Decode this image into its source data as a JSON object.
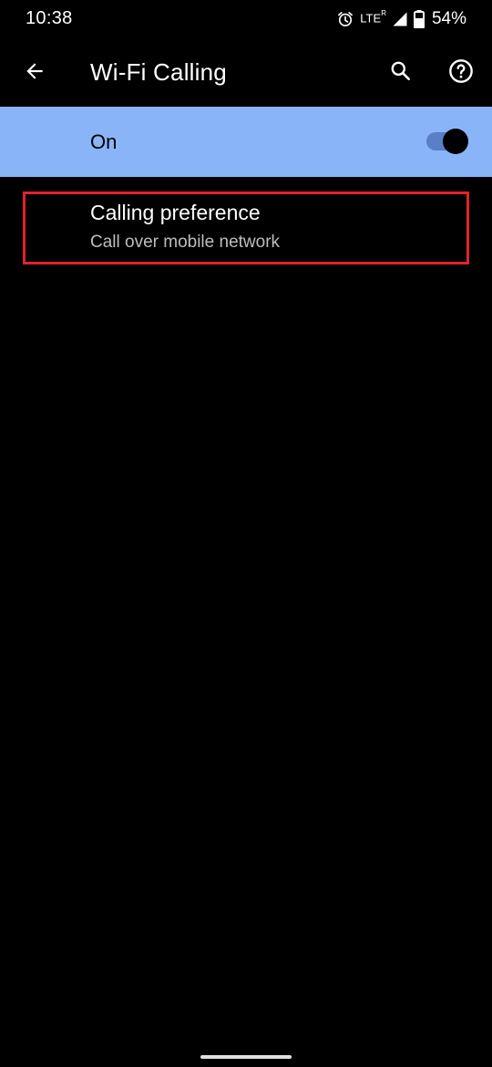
{
  "status_bar": {
    "time": "10:38",
    "network": "LTE",
    "roaming": "R",
    "battery_percent": "54%",
    "icons": [
      "alarm-icon",
      "signal-icon",
      "battery-icon"
    ]
  },
  "app_bar": {
    "title": "Wi-Fi Calling",
    "back_icon": "arrow-back-icon",
    "search_icon": "search-icon",
    "help_icon": "help-icon"
  },
  "main_switch": {
    "label": "On",
    "checked": true,
    "accent_color": "#8ab4f8"
  },
  "preferences": [
    {
      "title": "Calling preference",
      "summary": "Call over mobile network",
      "highlight_color": "#e3212c"
    }
  ]
}
